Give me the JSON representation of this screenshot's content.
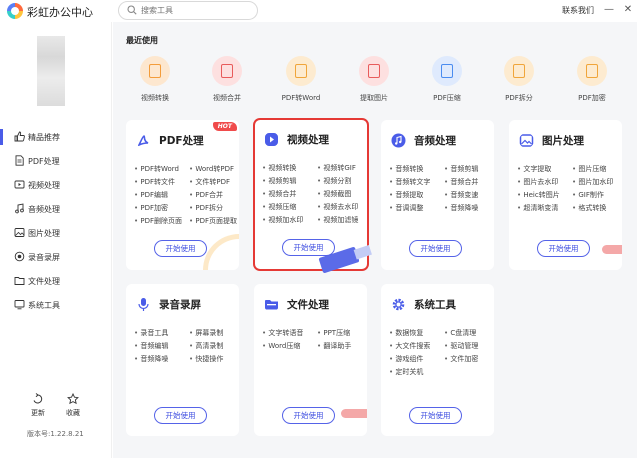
{
  "app": {
    "title": "彩虹办公中心"
  },
  "search": {
    "placeholder": "搜索工具"
  },
  "header": {
    "contact": "联系我们"
  },
  "sidebar": {
    "items": [
      {
        "label": "精品推荐",
        "icon": "thumbs-up-icon",
        "active": true
      },
      {
        "label": "PDF处理",
        "icon": "pdf-icon"
      },
      {
        "label": "视频处理",
        "icon": "video-icon"
      },
      {
        "label": "音频处理",
        "icon": "music-icon"
      },
      {
        "label": "图片处理",
        "icon": "image-icon"
      },
      {
        "label": "录音录屏",
        "icon": "record-icon"
      },
      {
        "label": "文件处理",
        "icon": "folder-icon"
      },
      {
        "label": "系统工具",
        "icon": "system-icon"
      }
    ],
    "update_label": "更新",
    "favorite_label": "收藏",
    "version": "版本号:1.22.8.21"
  },
  "recent": {
    "title": "最近使用",
    "items": [
      {
        "label": "视频转换",
        "color": "#fde7cf",
        "accent": "#f39c3a"
      },
      {
        "label": "视频合并",
        "color": "#fde0e0",
        "accent": "#e85b5b"
      },
      {
        "label": "PDF转Word",
        "color": "#fdebd0",
        "accent": "#f0a53a"
      },
      {
        "label": "提取图片",
        "color": "#fde0e0",
        "accent": "#e85b5b"
      },
      {
        "label": "PDF压缩",
        "color": "#dfeafd",
        "accent": "#4a8cf0"
      },
      {
        "label": "PDF拆分",
        "color": "#fdebd0",
        "accent": "#f0a53a"
      },
      {
        "label": "PDF加密",
        "color": "#fdebd0",
        "accent": "#f0a53a"
      }
    ]
  },
  "cards": [
    {
      "title": "PDF处理",
      "hot": "HOT",
      "icon": "pdf-icon",
      "color": "#4a5ce8",
      "features": [
        "PDF转Word",
        "Word转PDF",
        "PDF转文件",
        "文件转PDF",
        "PDF编辑",
        "PDF合并",
        "PDF加密",
        "PDF拆分",
        "PDF删除页面",
        "PDF页面提取"
      ],
      "button": "开始使用"
    },
    {
      "title": "视频处理",
      "icon": "video-icon",
      "color": "#4a5ce8",
      "features": [
        "视频转换",
        "视频转GIF",
        "视频剪辑",
        "视频分割",
        "视频合并",
        "视频截图",
        "视频压缩",
        "视频去水印",
        "视频加水印",
        "视频加滤镜"
      ],
      "button": "开始使用"
    },
    {
      "title": "音频处理",
      "icon": "music-icon",
      "color": "#4a5ce8",
      "features": [
        "音频转换",
        "音频剪辑",
        "音频转文字",
        "音频合并",
        "音频提取",
        "音频变速",
        "音调调整",
        "音频降噪"
      ],
      "button": "开始使用"
    },
    {
      "title": "图片处理",
      "icon": "image-icon",
      "color": "#4a5ce8",
      "features": [
        "文字提取",
        "图片压缩",
        "图片去水印",
        "图片加水印",
        "Heic转图片",
        "GIF制作",
        "超清晰变清",
        "格式转换"
      ],
      "button": "开始使用"
    },
    {
      "title": "录音录屏",
      "icon": "record-icon",
      "color": "#4a5ce8",
      "features": [
        "录音工具",
        "屏幕录制",
        "音频编辑",
        "高清录制",
        "音频降噪",
        "快捷操作"
      ],
      "button": "开始使用"
    },
    {
      "title": "文件处理",
      "icon": "folder-icon",
      "color": "#4a5ce8",
      "features": [
        "文字转语音",
        "PPT压缩",
        "Word压缩",
        "翻译助手"
      ],
      "button": "开始使用"
    },
    {
      "title": "系统工具",
      "icon": "gear-icon",
      "color": "#4a5ce8",
      "features": [
        "数据恢复",
        "C盘清理",
        "大文件搜索",
        "驱动管理",
        "游戏组件",
        "文件加密",
        "定时关机"
      ],
      "button": "开始使用"
    }
  ]
}
